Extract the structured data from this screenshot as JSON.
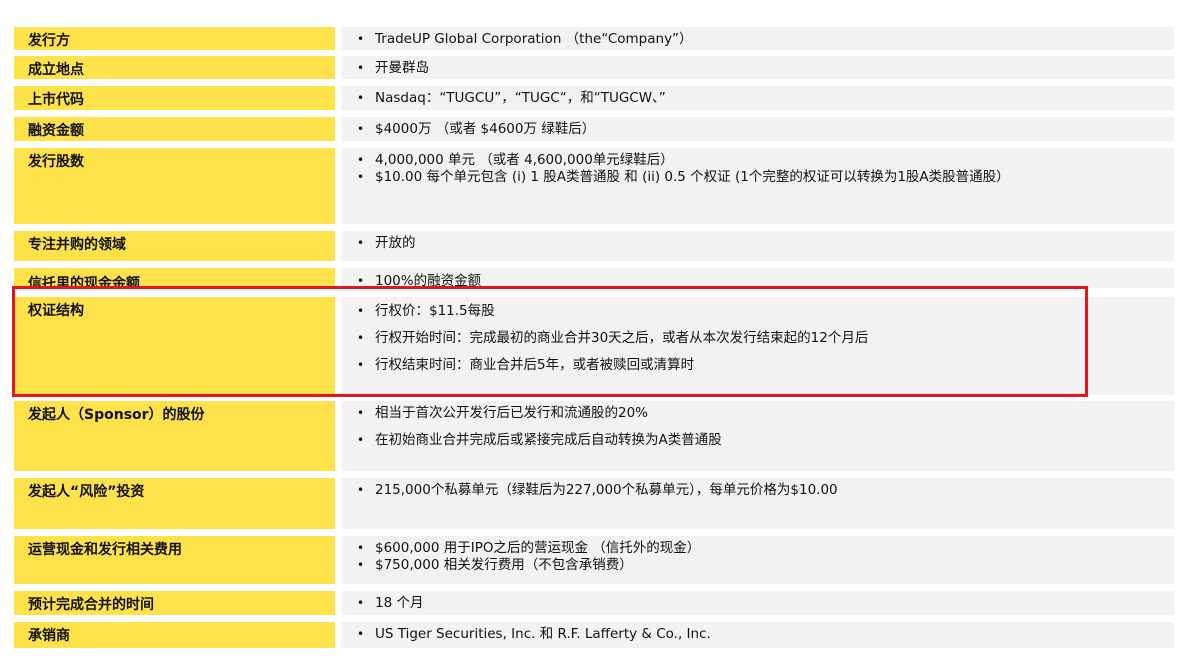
{
  "rows": [
    {
      "label": "发行方",
      "bullets": [
        "TradeUP Global Corporation （the“Company”）"
      ]
    },
    {
      "label": "成立地点",
      "bullets": [
        "开曼群岛"
      ]
    },
    {
      "label": "上市代码",
      "bullets": [
        "Nasdaq：“TUGCU”，“TUGC“，和“TUGCW、”"
      ]
    },
    {
      "label": "融资金额",
      "bullets": [
        "$4000万 （或者 $4600万 绿鞋后）"
      ]
    },
    {
      "label": "发行股数",
      "bullets": [
        "4,000,000 单元 （或者 4,600,000单元绿鞋后）",
        "$10.00 每个单元包含 (i) 1 股A类普通股 和 (ii) 0.5 个权证 (1个完整的权证可以转换为1股A类股普通股）"
      ]
    },
    {
      "label": "专注并购的领域",
      "bullets": [
        "开放的"
      ]
    },
    {
      "label": "信托里的现金金额",
      "bullets": [
        "100%的融资金额"
      ]
    },
    {
      "label": "权证结构",
      "bullets": [
        "行权价：$11.5每股",
        "行权开始时间：完成最初的商业合并30天之后，或者从本次发行结束起的12个月后",
        "行权结束时间：商业合并后5年，或者被赎回或清算时"
      ]
    },
    {
      "label": "发起人（Sponsor）的股份",
      "bullets": [
        "相当于首次公开发行后已发行和流通股的20%",
        "在初始商业合并完成后或紧接完成后自动转换为A类普通股"
      ]
    },
    {
      "label": "发起人“风险”投资",
      "bullets": [
        "215,000个私募单元（绿鞋后为227,000个私募单元），每单元价格为$10.00"
      ]
    },
    {
      "label": "运营现金和发行相关费用",
      "bullets": [
        "$600,000 用于IPO之后的营运现金 （信托外的现金）",
        "$750,000 相关发行费用（不包含承销费）"
      ]
    },
    {
      "label": "预计完成合并的时间",
      "bullets": [
        "18 个月"
      ]
    },
    {
      "label": "承销商",
      "bullets": [
        "US Tiger Securities, Inc. 和 R.F. Lafferty & Co., Inc."
      ]
    }
  ],
  "bullet_symbol": "•",
  "colors": {
    "label_bg": "#ffe14a",
    "content_bg": "#f2f2f2",
    "highlight_border": "#e8141b"
  }
}
